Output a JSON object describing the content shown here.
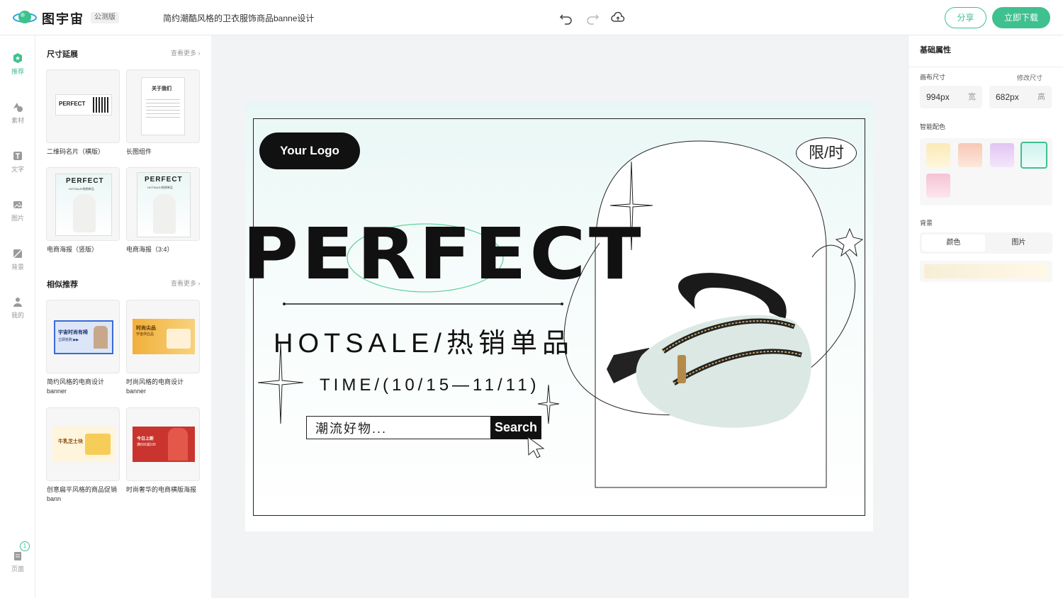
{
  "header": {
    "brand": "图宇宙",
    "badge": "公测版",
    "doc_title": "简约潮酷风格的卫衣服饰商品banne设计",
    "share_label": "分享",
    "download_label": "立即下载",
    "icons": [
      "undo-icon",
      "redo-icon",
      "cloud-save-icon"
    ]
  },
  "leftnav": {
    "items": [
      {
        "label": "推荐",
        "icon": "recommend-icon",
        "active": true
      },
      {
        "label": "素材",
        "icon": "shapes-icon"
      },
      {
        "label": "文字",
        "icon": "text-icon"
      },
      {
        "label": "图片",
        "icon": "image-icon"
      },
      {
        "label": "背景",
        "icon": "background-icon"
      },
      {
        "label": "我的",
        "icon": "user-icon"
      }
    ],
    "pages": {
      "label": "页面",
      "count": "1"
    }
  },
  "panel": {
    "size_section": {
      "title": "尺寸延展",
      "more": "查看更多"
    },
    "size_items": [
      {
        "label": "二维码名片（横版）"
      },
      {
        "label": "长图组件"
      },
      {
        "label": "电商海报（竖版）"
      },
      {
        "label": "电商海报（3:4）"
      }
    ],
    "similar_section": {
      "title": "相似推荐",
      "more": "查看更多"
    },
    "similar_items": [
      {
        "label": "简约风格的电商设计",
        "sub": "banner"
      },
      {
        "label": "时尚风格的电商设计",
        "sub": "banner"
      },
      {
        "label": "创意扁平风格的商品促销",
        "sub": "bann"
      },
      {
        "label": "时尚奢华的电商横版海报",
        "sub": ""
      }
    ],
    "thumb_text": {
      "qr_card": "PERFECT",
      "long_img": "关于我们",
      "poster1": "PERFECT",
      "poster1_sub": "HOTSALE/热销单品",
      "poster2": "PERFECT",
      "poster2_sub": "HOTSALE/热销单品",
      "sim1": "宇宙时尚有椅",
      "sim1_sub": "立即抢购 ▶▶",
      "sim2": "时尚尖品",
      "sim2_sub": "宇宙供应品",
      "sim3": "牛乳芝士块",
      "sim4": "今日上新",
      "sim4_sub": "满500减100"
    }
  },
  "artboard": {
    "logo": "Your Logo",
    "limited": "限/时",
    "headline": "PERFECT",
    "hotsale": "HOTSALE/热销单品",
    "time": "TIME/(10/15—11/11)",
    "search_placeholder": "潮流好物...",
    "search_button": "Search"
  },
  "rightpanel": {
    "title": "基础属性",
    "canvas_size_label": "画布尺寸",
    "resize_label": "修改尺寸",
    "width_value": "994px",
    "width_unit": "宽",
    "height_value": "682px",
    "height_unit": "高",
    "smart_color_label": "智能配色",
    "swatches": [
      "#fbe9b8",
      "#f7c8b5",
      "#e2c4f3",
      "#cdf3ec",
      "#f5c2d4"
    ],
    "selected_swatch": 3,
    "background_label": "背景",
    "bg_tabs": [
      "颜色",
      "图片"
    ],
    "accent": "#3fc08f"
  }
}
